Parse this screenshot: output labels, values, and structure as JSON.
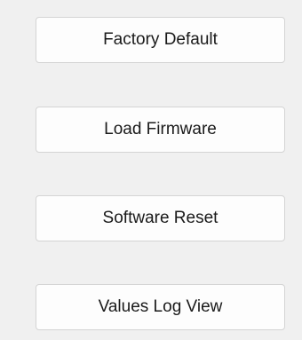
{
  "buttons": {
    "factory_default": "Factory Default",
    "load_firmware": "Load Firmware",
    "software_reset": "Software Reset",
    "values_log_view": "Values Log View"
  }
}
